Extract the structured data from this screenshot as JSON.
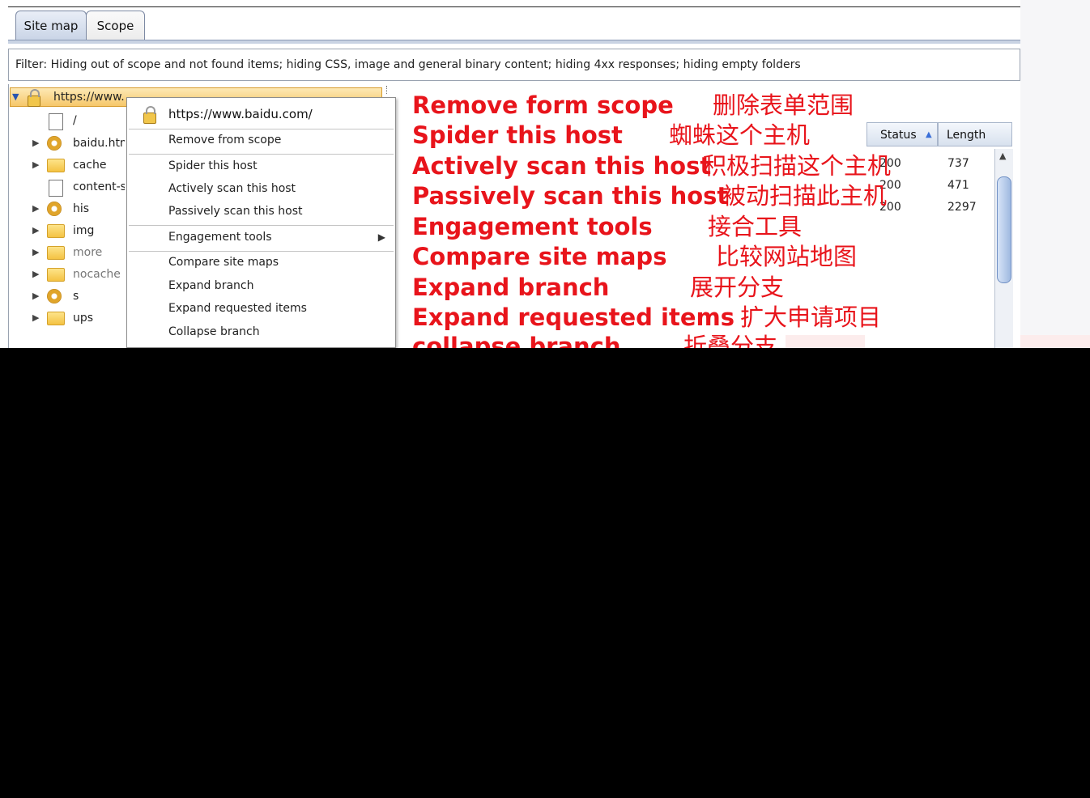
{
  "tabs": {
    "site_map": "Site map",
    "scope": "Scope"
  },
  "filter": "Filter:  Hiding out of scope and not found items;  hiding CSS, image and general binary content;  hiding 4xx responses;  hiding empty folders",
  "tree": {
    "root": "https://www.baidu.com/",
    "items": [
      "/",
      "baidu.htm",
      "cache",
      "content-s",
      "his",
      "img",
      "more",
      "nocache",
      "s",
      "ups"
    ]
  },
  "context_menu": {
    "header": "https://www.baidu.com/",
    "items": [
      "Remove from scope",
      "Spider this host",
      "Actively scan this host",
      "Passively scan this host",
      "Engagement tools",
      "Compare site maps",
      "Expand branch",
      "Expand requested items",
      "Collapse branch"
    ]
  },
  "table": {
    "columns": [
      "Status",
      "Length"
    ],
    "rows": [
      {
        "status": "200",
        "length": "737"
      },
      {
        "status": "200",
        "length": "471"
      },
      {
        "status": "200",
        "length": "2297"
      }
    ]
  },
  "annotations": [
    {
      "en": "Remove form scope",
      "cn": "删除表单范围"
    },
    {
      "en": "Spider this host",
      "cn": "蜘蛛这个主机"
    },
    {
      "en": "Actively scan this host",
      "cn": "积极扫描这个主机"
    },
    {
      "en": "Passively scan this host",
      "cn": "被动扫描此主机"
    },
    {
      "en": "Engagement tools",
      "cn": "接合工具"
    },
    {
      "en": "Compare site maps",
      "cn": "比较网站地图"
    },
    {
      "en": "Expand branch",
      "cn": "展开分支"
    },
    {
      "en": "Expand requested items",
      "cn": "扩大申请项目"
    },
    {
      "en": "collapse branch",
      "cn": "折叠分支"
    }
  ],
  "colors": {
    "annotation": "#e8141b",
    "selection": "#f6c76a",
    "tab_active": "#c9d4e6"
  }
}
